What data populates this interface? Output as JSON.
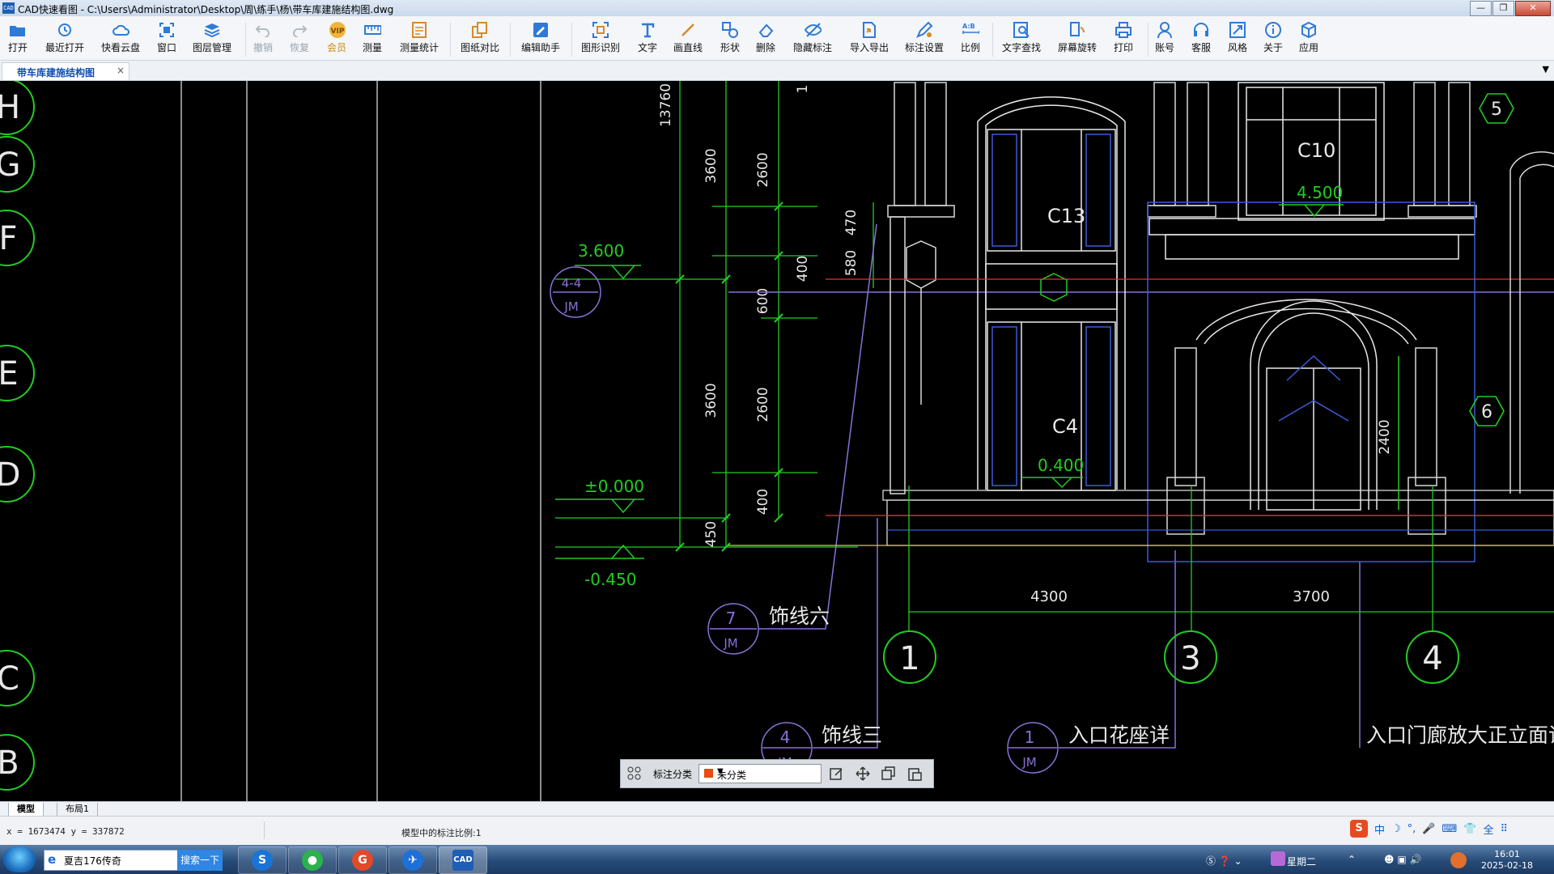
{
  "window": {
    "title": "CAD快速看图 - C:\\Users\\Administrator\\Desktop\\周\\练手\\杨\\带车库建施结构图.dwg",
    "app_icon_text": "CAD"
  },
  "toolbar": {
    "items": [
      {
        "label": "打开",
        "icon": "folder-icon"
      },
      {
        "label": "最近打开",
        "icon": "history-icon"
      },
      {
        "label": "快看云盘",
        "icon": "cloud-icon"
      },
      {
        "label": "窗口",
        "icon": "window-icon"
      },
      {
        "label": "图层管理",
        "icon": "layers-icon"
      },
      {
        "label": "撤销",
        "icon": "undo-icon"
      },
      {
        "label": "恢复",
        "icon": "redo-icon"
      },
      {
        "label": "会员",
        "icon": "vip-icon"
      },
      {
        "label": "测量",
        "icon": "ruler-icon"
      },
      {
        "label": "测量统计",
        "icon": "measure-stats-icon"
      },
      {
        "label": "图纸对比",
        "icon": "compare-icon"
      },
      {
        "label": "编辑助手",
        "icon": "edit-assistant-icon"
      },
      {
        "label": "图形识别",
        "icon": "shape-recognition-icon"
      },
      {
        "label": "文字",
        "icon": "text-icon"
      },
      {
        "label": "画直线",
        "icon": "line-icon"
      },
      {
        "label": "形状",
        "icon": "shapes-icon"
      },
      {
        "label": "删除",
        "icon": "eraser-icon"
      },
      {
        "label": "隐藏标注",
        "icon": "hide-eye-icon"
      },
      {
        "label": "导入导出",
        "icon": "import-export-icon"
      },
      {
        "label": "标注设置",
        "icon": "annotation-settings-icon"
      },
      {
        "label": "比例",
        "icon": "scale-icon"
      },
      {
        "label": "文字查找",
        "icon": "text-search-icon"
      },
      {
        "label": "屏幕旋转",
        "icon": "rotate-screen-icon"
      },
      {
        "label": "打印",
        "icon": "printer-icon"
      },
      {
        "label": "账号",
        "icon": "user-icon"
      },
      {
        "label": "客服",
        "icon": "headset-icon"
      },
      {
        "label": "风格",
        "icon": "style-icon"
      },
      {
        "label": "关于",
        "icon": "info-icon"
      },
      {
        "label": "应用",
        "icon": "apps-cube-icon"
      }
    ]
  },
  "tabs": {
    "active": "带车库建施结构图",
    "close": "×",
    "menu": "▼"
  },
  "drawing": {
    "grid_bubbles_left": [
      "H",
      "G",
      "F",
      "E",
      "D",
      "C",
      "B"
    ],
    "grid_bubbles_bottom": [
      "1",
      "3",
      "4"
    ],
    "bubbles_right": [
      "5",
      "6"
    ],
    "elevations": [
      "3.600",
      "±0.000",
      "-0.450"
    ],
    "total_dim": "13760",
    "dims_col1": [
      "3600",
      "3600",
      "450"
    ],
    "dims_col2": [
      "2600",
      "600",
      "2600",
      "400"
    ],
    "dims_col3": [
      "400",
      "580",
      "470"
    ],
    "dim_top_cut": "1",
    "bottom_dims": [
      "4300",
      "3700"
    ],
    "windows": [
      "C13",
      "C10",
      "C4"
    ],
    "window_elevs": [
      "4.500",
      "0.400"
    ],
    "door_dim": "2400",
    "detail_refs": [
      {
        "num": "4-4",
        "sheet": "JM"
      },
      {
        "num": "7",
        "sheet": "JM",
        "text": "饰线六"
      },
      {
        "num": "4",
        "sheet": "JM",
        "text": "饰线三"
      },
      {
        "num": "1",
        "sheet": "JM",
        "text": "入口花座详"
      }
    ],
    "detail_text_4": "入口门廊放大正立面详"
  },
  "annotation_bar": {
    "label": "标注分类",
    "selected": "未分类",
    "color": "#e84d14"
  },
  "layout_tabs": [
    "模型",
    "布局1"
  ],
  "status": {
    "coords": "x = 1673474  y = 337872",
    "scale": "模型中的标注比例:1"
  },
  "ime": [
    "S",
    "中",
    "☽",
    "°,",
    "🎤",
    "⌨",
    "👕",
    "全",
    "⠿"
  ],
  "taskbar": {
    "search_text": "夏吉176传奇",
    "search_button": "搜索一下",
    "day": "星期二",
    "time": "16:01",
    "date": "2025-02-18"
  }
}
